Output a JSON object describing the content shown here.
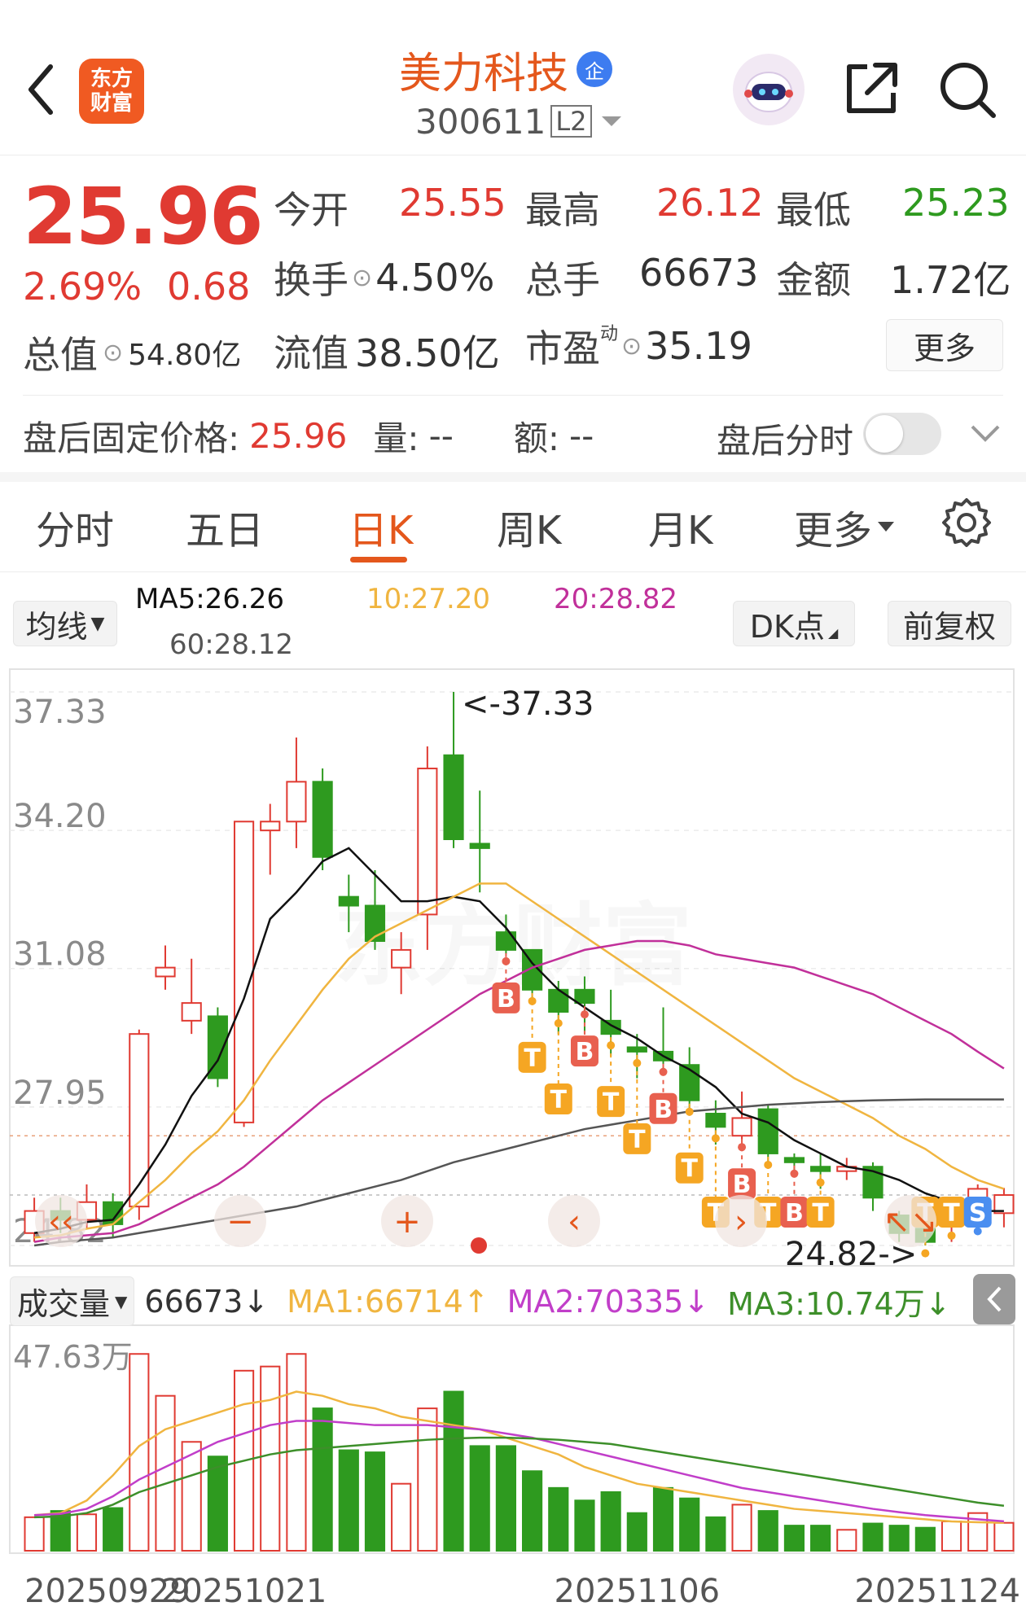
{
  "header": {
    "back_icon": "chevron-left-icon",
    "logo_text_line1": "东方",
    "logo_text_line2": "财富",
    "stock_name": "美力科技",
    "badge": "企",
    "stock_code": "300611",
    "level": "L2",
    "robot_icon": "robot-assistant-icon",
    "share_icon": "share-icon",
    "search_icon": "search-icon"
  },
  "quote": {
    "price": "25.96",
    "change_pct": "2.69%",
    "change": "0.68",
    "open_label": "今开",
    "open": "25.55",
    "high_label": "最高",
    "high": "26.12",
    "low_label": "最低",
    "low": "25.23",
    "turnover_label": "换手",
    "turnover": "4.50%",
    "volume_label": "总手",
    "volume": "66673",
    "amount_label": "金额",
    "amount": "1.72亿",
    "mktcap_label": "总值",
    "mktcap": "54.80亿",
    "float_label": "流值",
    "float": "38.50亿",
    "pe_label": "市盈",
    "pe_sup": "动",
    "pe": "35.19",
    "more": "更多"
  },
  "afterhours": {
    "label": "盘后固定价格:",
    "price": "25.96",
    "vol_label": "量:",
    "vol": "--",
    "amt_label": "额:",
    "amt": "--",
    "timeshare_label": "盘后分时"
  },
  "tabs": [
    "分时",
    "五日",
    "日K",
    "周K",
    "月K",
    "更多"
  ],
  "active_tab": "日K",
  "ma_bar": {
    "selector": "均线",
    "ma5": "MA5:26.26",
    "ma10": "10:27.20",
    "ma20": "20:28.82",
    "ma60": "60:28.12",
    "dk": "DK点",
    "adjust": "前复权"
  },
  "vol_bar": {
    "selector": "成交量",
    "vol": "66673",
    "ma1": "MA1:66714",
    "ma2": "MA2:70335",
    "ma3": "MA3:10.74万"
  },
  "colors": {
    "up": "#e03a32",
    "down": "#2e9a1f",
    "ma5": "#111111",
    "ma10": "#f0b540",
    "ma20": "#c1309a",
    "ma60": "#555555",
    "vol_ma1": "#f0b540",
    "vol_ma2": "#c13ec9",
    "vol_ma3": "#3d8f2a",
    "accent": "#e4571c"
  },
  "chart_data": {
    "type": "candlestick",
    "y_axis_labels": [
      "37.33",
      "34.20",
      "31.08",
      "27.95",
      "24.82"
    ],
    "ylim": [
      24.82,
      37.33
    ],
    "max_label": "<-37.33",
    "min_label": "24.82->",
    "x_labels": [
      "20250929",
      "20251021",
      "20251106",
      "20251124"
    ],
    "volume_axis_label": "47.63万",
    "candles": [
      {
        "o": 25.1,
        "c": 25.6,
        "h": 25.9,
        "l": 24.9,
        "v": 80000
      },
      {
        "o": 25.6,
        "c": 25.4,
        "h": 25.9,
        "l": 25.1,
        "v": 95000
      },
      {
        "o": 25.4,
        "c": 25.8,
        "h": 26.2,
        "l": 25.2,
        "v": 87000
      },
      {
        "o": 25.8,
        "c": 25.3,
        "h": 26.0,
        "l": 25.0,
        "v": 102000
      },
      {
        "o": 25.7,
        "c": 29.6,
        "h": 29.7,
        "l": 25.4,
        "v": 470000
      },
      {
        "o": 30.9,
        "c": 31.1,
        "h": 31.6,
        "l": 30.6,
        "v": 370000
      },
      {
        "o": 29.9,
        "c": 30.3,
        "h": 31.3,
        "l": 29.6,
        "v": 260000
      },
      {
        "o": 30.0,
        "c": 28.6,
        "h": 30.2,
        "l": 28.4,
        "v": 225000
      },
      {
        "o": 27.6,
        "c": 34.4,
        "h": 34.4,
        "l": 27.5,
        "v": 430000
      },
      {
        "o": 34.2,
        "c": 34.4,
        "h": 34.8,
        "l": 33.2,
        "v": 440000
      },
      {
        "o": 34.4,
        "c": 35.3,
        "h": 36.3,
        "l": 33.8,
        "v": 470000
      },
      {
        "o": 35.3,
        "c": 33.6,
        "h": 35.6,
        "l": 33.3,
        "v": 340000
      },
      {
        "o": 32.7,
        "c": 32.5,
        "h": 33.2,
        "l": 31.9,
        "v": 240000
      },
      {
        "o": 32.5,
        "c": 31.7,
        "h": 33.3,
        "l": 31.5,
        "v": 235000
      },
      {
        "o": 31.1,
        "c": 31.5,
        "h": 31.9,
        "l": 30.5,
        "v": 160000
      },
      {
        "o": 32.3,
        "c": 35.6,
        "h": 36.1,
        "l": 31.5,
        "v": 340000
      },
      {
        "o": 35.9,
        "c": 34.0,
        "h": 37.33,
        "l": 33.8,
        "v": 380000
      },
      {
        "o": 33.9,
        "c": 33.8,
        "h": 35.1,
        "l": 32.8,
        "v": 250000
      },
      {
        "o": 31.9,
        "c": 31.5,
        "h": 32.3,
        "l": 31.4,
        "v": 250000
      },
      {
        "o": 31.5,
        "c": 30.6,
        "h": 31.5,
        "l": 30.4,
        "v": 190000
      },
      {
        "o": 30.6,
        "c": 30.1,
        "h": 30.8,
        "l": 29.6,
        "v": 150000
      },
      {
        "o": 30.6,
        "c": 30.3,
        "h": 30.9,
        "l": 29.6,
        "v": 120000
      },
      {
        "o": 29.9,
        "c": 29.6,
        "h": 30.6,
        "l": 29.1,
        "v": 140000
      },
      {
        "o": 29.3,
        "c": 29.2,
        "h": 29.6,
        "l": 28.6,
        "v": 90000
      },
      {
        "o": 29.2,
        "c": 29.0,
        "h": 30.2,
        "l": 28.7,
        "v": 150000
      },
      {
        "o": 28.9,
        "c": 28.1,
        "h": 29.3,
        "l": 27.9,
        "v": 125000
      },
      {
        "o": 27.8,
        "c": 27.5,
        "h": 28.1,
        "l": 27.1,
        "v": 80000
      },
      {
        "o": 27.3,
        "c": 27.7,
        "h": 28.3,
        "l": 27.1,
        "v": 110000
      },
      {
        "o": 27.9,
        "c": 26.9,
        "h": 28.0,
        "l": 26.7,
        "v": 95000
      },
      {
        "o": 26.8,
        "c": 26.7,
        "h": 26.9,
        "l": 26.5,
        "v": 60000
      },
      {
        "o": 26.6,
        "c": 26.5,
        "h": 26.9,
        "l": 26.1,
        "v": 60000
      },
      {
        "o": 26.5,
        "c": 26.6,
        "h": 26.8,
        "l": 26.3,
        "v": 50000
      },
      {
        "o": 26.6,
        "c": 25.9,
        "h": 26.7,
        "l": 25.6,
        "v": 65000
      },
      {
        "o": 25.5,
        "c": 25.1,
        "h": 25.6,
        "l": 24.9,
        "v": 60000
      },
      {
        "o": 25.2,
        "c": 24.9,
        "h": 25.4,
        "l": 24.82,
        "v": 55000
      },
      {
        "o": 25.3,
        "c": 25.6,
        "h": 25.9,
        "l": 24.9,
        "v": 70000
      },
      {
        "o": 25.4,
        "c": 26.1,
        "h": 26.2,
        "l": 25.2,
        "v": 90000
      },
      {
        "o": 25.55,
        "c": 25.96,
        "h": 26.12,
        "l": 25.23,
        "v": 66673
      }
    ],
    "series": [
      {
        "name": "MA5",
        "values": [
          25.1,
          25.2,
          25.35,
          25.4,
          26.2,
          27.1,
          28.2,
          29.0,
          30.4,
          32.2,
          32.8,
          33.5,
          33.8,
          33.2,
          32.6,
          32.6,
          32.7,
          32.6,
          32.0,
          31.2,
          30.6,
          30.2,
          29.8,
          29.5,
          29.1,
          28.8,
          28.4,
          27.8,
          27.6,
          27.2,
          26.9,
          26.6,
          26.5,
          26.3,
          26.0,
          25.8,
          25.6,
          25.6
        ]
      },
      {
        "name": "MA10",
        "values": [
          25.0,
          25.05,
          25.2,
          25.3,
          25.8,
          26.3,
          26.9,
          27.4,
          28.1,
          29.0,
          29.8,
          30.6,
          31.3,
          31.8,
          32.1,
          32.4,
          32.7,
          33.0,
          33.0,
          32.6,
          32.2,
          31.8,
          31.4,
          31.0,
          30.6,
          30.2,
          29.8,
          29.4,
          29.0,
          28.6,
          28.3,
          28.0,
          27.7,
          27.3,
          27.0,
          26.6,
          26.3,
          26.1
        ]
      },
      {
        "name": "MA20",
        "values": [
          24.9,
          25.0,
          25.05,
          25.1,
          25.3,
          25.6,
          25.9,
          26.2,
          26.6,
          27.1,
          27.6,
          28.1,
          28.5,
          28.9,
          29.3,
          29.7,
          30.1,
          30.5,
          30.8,
          31.1,
          31.3,
          31.5,
          31.6,
          31.7,
          31.7,
          31.6,
          31.4,
          31.3,
          31.2,
          31.1,
          30.9,
          30.7,
          30.5,
          30.2,
          29.9,
          29.6,
          29.2,
          28.82
        ]
      },
      {
        "name": "MA60",
        "values": [
          24.82,
          24.9,
          24.95,
          25.0,
          25.1,
          25.2,
          25.3,
          25.4,
          25.5,
          25.6,
          25.7,
          25.85,
          26.0,
          26.15,
          26.3,
          26.5,
          26.7,
          26.85,
          27.0,
          27.15,
          27.3,
          27.45,
          27.55,
          27.65,
          27.75,
          27.85,
          27.9,
          27.95,
          28.0,
          28.03,
          28.06,
          28.08,
          28.1,
          28.11,
          28.12,
          28.12,
          28.12,
          28.12
        ]
      },
      {
        "name": "MA1",
        "axis": "volume",
        "values": [
          85000,
          90000,
          120000,
          180000,
          250000,
          290000,
          310000,
          330000,
          350000,
          360000,
          380000,
          370000,
          350000,
          340000,
          320000,
          310000,
          300000,
          290000,
          270000,
          250000,
          230000,
          200000,
          180000,
          160000,
          150000,
          140000,
          130000,
          120000,
          110000,
          100000,
          95000,
          90000,
          85000,
          80000,
          75000,
          70000,
          68000,
          66714
        ]
      },
      {
        "name": "MA2",
        "axis": "volume",
        "values": [
          85000,
          88000,
          100000,
          130000,
          170000,
          200000,
          230000,
          260000,
          280000,
          300000,
          310000,
          310000,
          305000,
          300000,
          300000,
          300000,
          295000,
          290000,
          280000,
          270000,
          255000,
          240000,
          225000,
          210000,
          195000,
          180000,
          165000,
          150000,
          140000,
          130000,
          120000,
          110000,
          100000,
          92000,
          85000,
          80000,
          75000,
          70335
        ]
      },
      {
        "name": "MA3",
        "axis": "volume",
        "values": [
          80000,
          82000,
          90000,
          110000,
          140000,
          160000,
          180000,
          200000,
          215000,
          230000,
          240000,
          245000,
          250000,
          255000,
          260000,
          265000,
          268000,
          270000,
          270000,
          268000,
          265000,
          260000,
          255000,
          245000,
          235000,
          225000,
          215000,
          205000,
          195000,
          185000,
          175000,
          165000,
          155000,
          145000,
          135000,
          125000,
          115000,
          107400
        ]
      }
    ],
    "signals": [
      {
        "i": 18,
        "t": "B"
      },
      {
        "i": 19,
        "t": "T"
      },
      {
        "i": 20,
        "t": "T"
      },
      {
        "i": 21,
        "t": "B"
      },
      {
        "i": 22,
        "t": "T"
      },
      {
        "i": 23,
        "t": "T"
      },
      {
        "i": 24,
        "t": "B"
      },
      {
        "i": 25,
        "t": "T"
      },
      {
        "i": 26,
        "t": "T"
      },
      {
        "i": 27,
        "t": "B"
      },
      {
        "i": 28,
        "t": "T"
      },
      {
        "i": 29,
        "t": "B"
      },
      {
        "i": 30,
        "t": "T"
      },
      {
        "i": 34,
        "t": "T"
      },
      {
        "i": 35,
        "t": "T"
      },
      {
        "i": 36,
        "t": "S"
      }
    ],
    "nav_icons": [
      "collapse-left-icon",
      "zoom-out-icon",
      "zoom-in-icon",
      "chevron-left-icon",
      "chevron-right-icon",
      "expand-icon"
    ]
  }
}
